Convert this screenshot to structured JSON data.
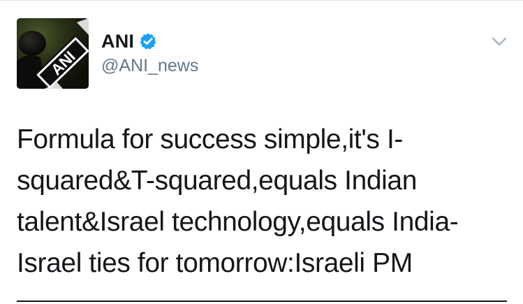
{
  "tweet": {
    "author": {
      "display_name": "ANI",
      "handle": "@ANI_news",
      "avatar_text": "ANI",
      "verified_icon": "verified-badge-icon"
    },
    "menu_icon": "chevron-down-icon",
    "text_lines": [
      "Formula for success simple,it's I-",
      "squared&T-squared,equals Indian",
      "talent&Israel technology,equals India-",
      "Israel ties for tomorrow:Israeli PM"
    ]
  },
  "colors": {
    "verified_blue": "#1da1f2",
    "text_primary": "#14171a",
    "text_secondary": "#657786",
    "caret": "#aab8c2"
  }
}
